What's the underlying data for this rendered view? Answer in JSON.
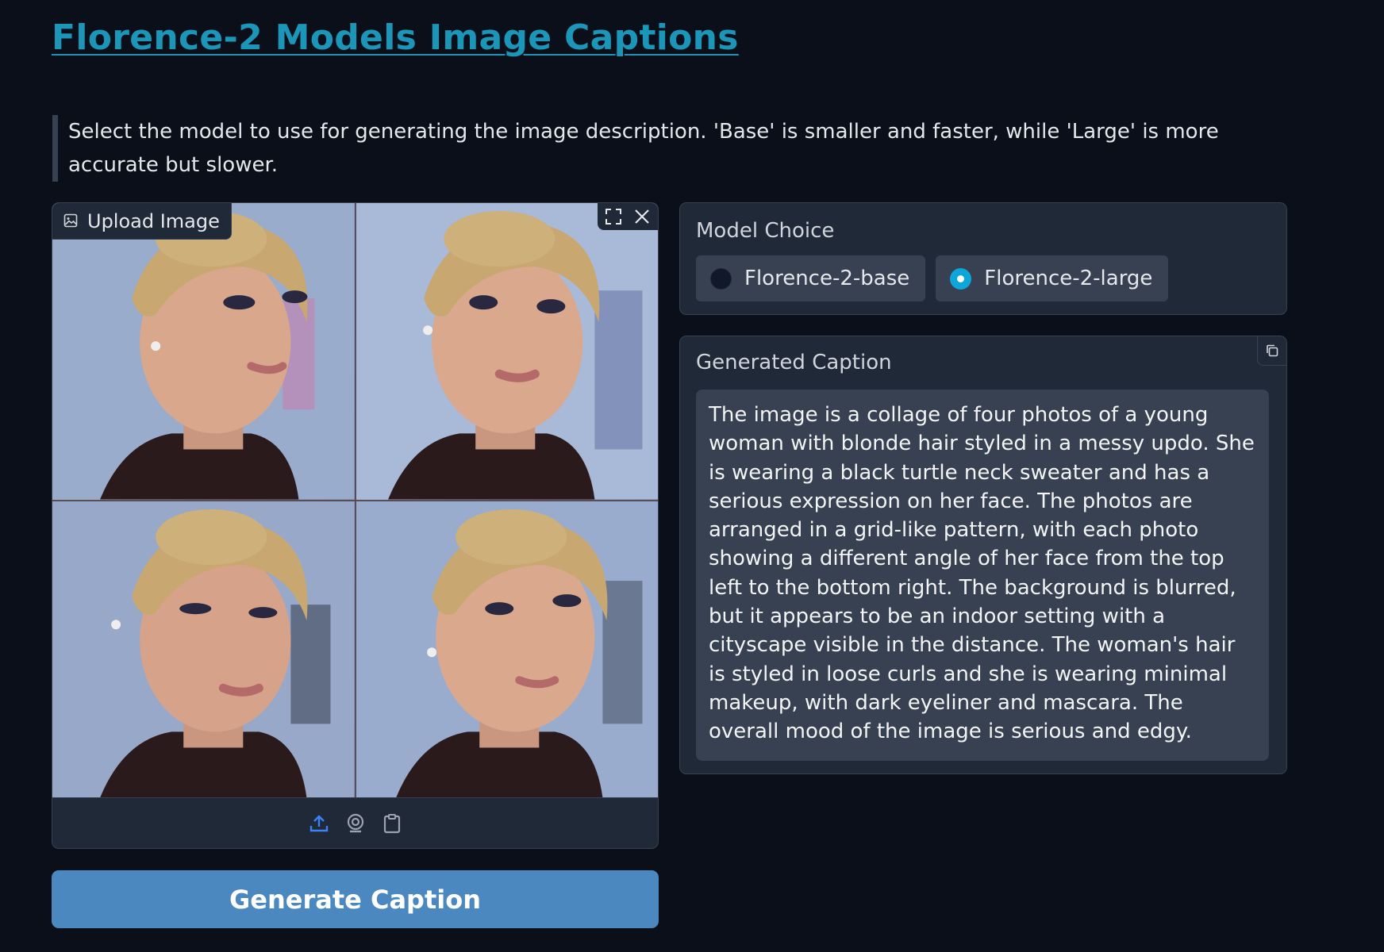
{
  "header": {
    "title": "Florence-2 Models Image Captions",
    "description": "Select the model to use for generating the image description. 'Base' is smaller and faster, while 'Large' is more accurate but slower."
  },
  "image_input": {
    "label": "Upload Image",
    "icons": [
      "image-icon",
      "fullscreen-icon",
      "close-icon",
      "upload-icon",
      "webcam-icon",
      "clipboard-icon"
    ]
  },
  "model_choice": {
    "label": "Model Choice",
    "options": [
      {
        "label": "Florence-2-base",
        "selected": false
      },
      {
        "label": "Florence-2-large",
        "selected": true
      }
    ]
  },
  "output": {
    "label": "Generated Caption",
    "caption": "The image is a collage of four photos of a young woman with blonde hair styled in a messy updo. She is wearing a black turtle neck sweater and has a serious expression on her face. The photos are arranged in a grid-like pattern, with each photo showing a different angle of her face from the top left to the bottom right. The background is blurred, but it appears to be an indoor setting with a cityscape visible in the distance. The woman's hair is styled in loose curls and she is wearing minimal makeup, with dark eyeliner and mascara. The overall mood of the image is serious and edgy."
  },
  "actions": {
    "generate_label": "Generate Caption"
  },
  "colors": {
    "background": "#0b0f19",
    "panel": "#1f2937",
    "accent": "#1b95b8",
    "button": "#4a88bf",
    "radio_selected": "#0ea5d9"
  }
}
